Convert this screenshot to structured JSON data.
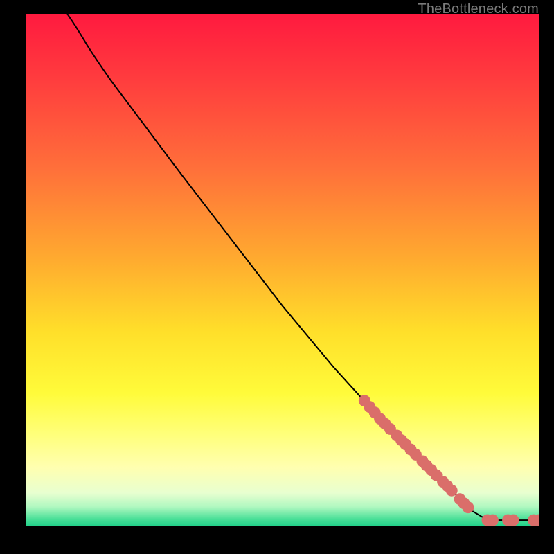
{
  "watermark": "TheBottleneck.com",
  "chart_data": {
    "type": "line",
    "title": "",
    "xlabel": "",
    "ylabel": "",
    "xlim": [
      0,
      100
    ],
    "ylim": [
      0,
      100
    ],
    "grid": false,
    "curve": {
      "name": "bottleneck-curve",
      "color": "#000000",
      "points": [
        {
          "x": 8,
          "y": 100
        },
        {
          "x": 10,
          "y": 97
        },
        {
          "x": 13,
          "y": 92
        },
        {
          "x": 20,
          "y": 82
        },
        {
          "x": 30,
          "y": 69
        },
        {
          "x": 40,
          "y": 56
        },
        {
          "x": 50,
          "y": 43
        },
        {
          "x": 60,
          "y": 31
        },
        {
          "x": 70,
          "y": 20
        },
        {
          "x": 80,
          "y": 10
        },
        {
          "x": 87,
          "y": 3
        },
        {
          "x": 90,
          "y": 1.2
        },
        {
          "x": 95,
          "y": 1.2
        },
        {
          "x": 100,
          "y": 1.2
        }
      ]
    },
    "markers": {
      "name": "highlighted-points",
      "color": "#da6e6a",
      "points": [
        {
          "x": 66,
          "y": 24.5
        },
        {
          "x": 67,
          "y": 23.3
        },
        {
          "x": 68,
          "y": 22.2
        },
        {
          "x": 69,
          "y": 21.0
        },
        {
          "x": 70,
          "y": 20.0
        },
        {
          "x": 71,
          "y": 19.0
        },
        {
          "x": 72.3,
          "y": 17.7
        },
        {
          "x": 73.2,
          "y": 16.8
        },
        {
          "x": 74,
          "y": 16.0
        },
        {
          "x": 75,
          "y": 15.0
        },
        {
          "x": 76,
          "y": 14.0
        },
        {
          "x": 77.3,
          "y": 12.7
        },
        {
          "x": 78.1,
          "y": 11.9
        },
        {
          "x": 79,
          "y": 11.0
        },
        {
          "x": 80,
          "y": 10.0
        },
        {
          "x": 81.3,
          "y": 8.7
        },
        {
          "x": 82.1,
          "y": 7.9
        },
        {
          "x": 83,
          "y": 7.0
        },
        {
          "x": 84.6,
          "y": 5.3
        },
        {
          "x": 85.4,
          "y": 4.5
        },
        {
          "x": 86.2,
          "y": 3.7
        },
        {
          "x": 90,
          "y": 1.2
        },
        {
          "x": 91,
          "y": 1.2
        },
        {
          "x": 94,
          "y": 1.2
        },
        {
          "x": 95,
          "y": 1.2
        },
        {
          "x": 99,
          "y": 1.2
        },
        {
          "x": 100,
          "y": 1.2
        }
      ]
    },
    "gradient_stops": [
      {
        "offset": 0.0,
        "color": "#ff1a3f"
      },
      {
        "offset": 0.12,
        "color": "#ff3a3e"
      },
      {
        "offset": 0.3,
        "color": "#ff6f3a"
      },
      {
        "offset": 0.48,
        "color": "#ffab2f"
      },
      {
        "offset": 0.62,
        "color": "#ffdf2a"
      },
      {
        "offset": 0.74,
        "color": "#fffb3a"
      },
      {
        "offset": 0.82,
        "color": "#ffff7a"
      },
      {
        "offset": 0.885,
        "color": "#ffffb0"
      },
      {
        "offset": 0.935,
        "color": "#e8ffd0"
      },
      {
        "offset": 0.962,
        "color": "#b0f8c0"
      },
      {
        "offset": 0.985,
        "color": "#4de099"
      },
      {
        "offset": 1.0,
        "color": "#1fd089"
      }
    ]
  }
}
